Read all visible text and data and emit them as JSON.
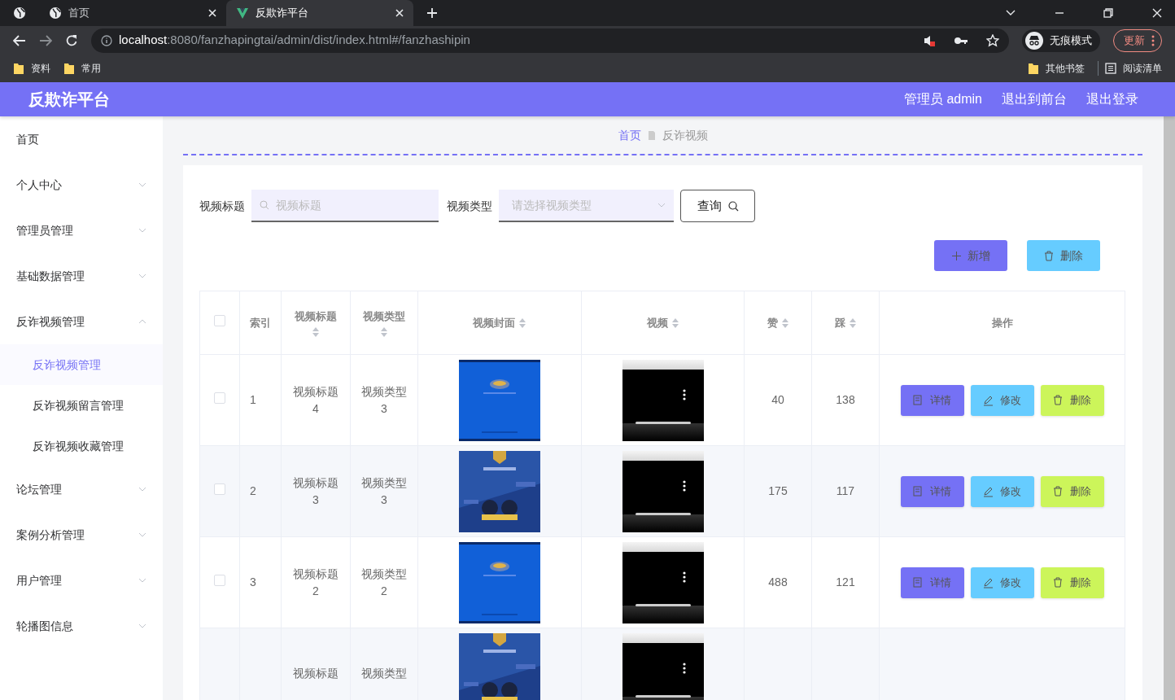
{
  "browser": {
    "tabs": [
      {
        "title": "首页",
        "selected": false
      },
      {
        "title": "反欺诈平台",
        "selected": true
      }
    ],
    "address": {
      "host": "localhost",
      "path": ":8080/fanzhapingtai/admin/dist/index.html#/fanzhashipin"
    },
    "profile": "无痕模式",
    "update_button": "更新",
    "bookmarks": [
      "资料",
      "常用"
    ],
    "other_bookmarks": "其他书签",
    "reading_list": "阅读清单"
  },
  "header": {
    "title": "反欺诈平台",
    "user": "管理员 admin",
    "links": [
      "退出到前台",
      "退出登录"
    ]
  },
  "sidebar": {
    "items": [
      {
        "label": "首页"
      },
      {
        "label": "个人中心",
        "expanded": false
      },
      {
        "label": "管理员管理",
        "expanded": false
      },
      {
        "label": "基础数据管理",
        "expanded": false
      },
      {
        "label": "反诈视频管理",
        "expanded": true,
        "children": [
          {
            "label": "反诈视频管理",
            "selected": true
          },
          {
            "label": "反诈视频留言管理",
            "selected": false
          },
          {
            "label": "反诈视频收藏管理",
            "selected": false
          }
        ]
      },
      {
        "label": "论坛管理",
        "expanded": false
      },
      {
        "label": "案例分析管理",
        "expanded": false
      },
      {
        "label": "用户管理",
        "expanded": false
      },
      {
        "label": "轮播图信息",
        "expanded": false
      }
    ]
  },
  "breadcrumb": [
    "首页",
    "反诈视频"
  ],
  "search": {
    "fields": [
      {
        "label": "视频标题",
        "kind": "text",
        "placeholder": "视频标题"
      },
      {
        "label": "视频类型",
        "kind": "select",
        "placeholder": "请选择视频类型"
      }
    ],
    "button": "查询"
  },
  "actions": [
    {
      "label": "新增",
      "kind": "add"
    },
    {
      "label": "删除",
      "kind": "delete"
    }
  ],
  "table": {
    "select_all_checked": false,
    "columns": [
      {
        "label": "索引",
        "sortable": false
      },
      {
        "label": "视频标题",
        "sortable": true
      },
      {
        "label": "视频类型",
        "sortable": true
      },
      {
        "label": "视频封面",
        "sortable": true
      },
      {
        "label": "视频",
        "sortable": true
      },
      {
        "label": "赞",
        "sortable": true
      },
      {
        "label": "踩",
        "sortable": true
      },
      {
        "label": "操作",
        "sortable": false
      }
    ],
    "rows": [
      {
        "checked": false,
        "index": "1",
        "title": "视频标题4",
        "type": "视频类型3",
        "cover": {
          "kind": "picture"
        },
        "likes": "40",
        "dislikes": "138",
        "buttons": [
          {
            "label": "详情",
            "kind": "detail"
          },
          {
            "label": "修改",
            "kind": "edit"
          },
          {
            "label": "删除",
            "kind": "delete"
          }
        ]
      },
      {
        "checked": false,
        "index": "2",
        "title": "视频标题3",
        "type": "视频类型3",
        "cover": {
          "kind": "picture"
        },
        "likes": "175",
        "dislikes": "117",
        "buttons": [
          {
            "label": "详情",
            "kind": "detail"
          },
          {
            "label": "修改",
            "kind": "edit"
          },
          {
            "label": "删除",
            "kind": "delete"
          }
        ]
      },
      {
        "checked": false,
        "index": "3",
        "title": "视频标题2",
        "type": "视频类型2",
        "cover": {
          "kind": "picture"
        },
        "likes": "488",
        "dislikes": "121",
        "buttons": [
          {
            "label": "详情",
            "kind": "detail"
          },
          {
            "label": "修改",
            "kind": "edit"
          },
          {
            "label": "删除",
            "kind": "delete"
          }
        ]
      },
      {
        "title": "视频标题",
        "type": "视频类型",
        "cover": {
          "kind": "picture"
        }
      }
    ]
  }
}
